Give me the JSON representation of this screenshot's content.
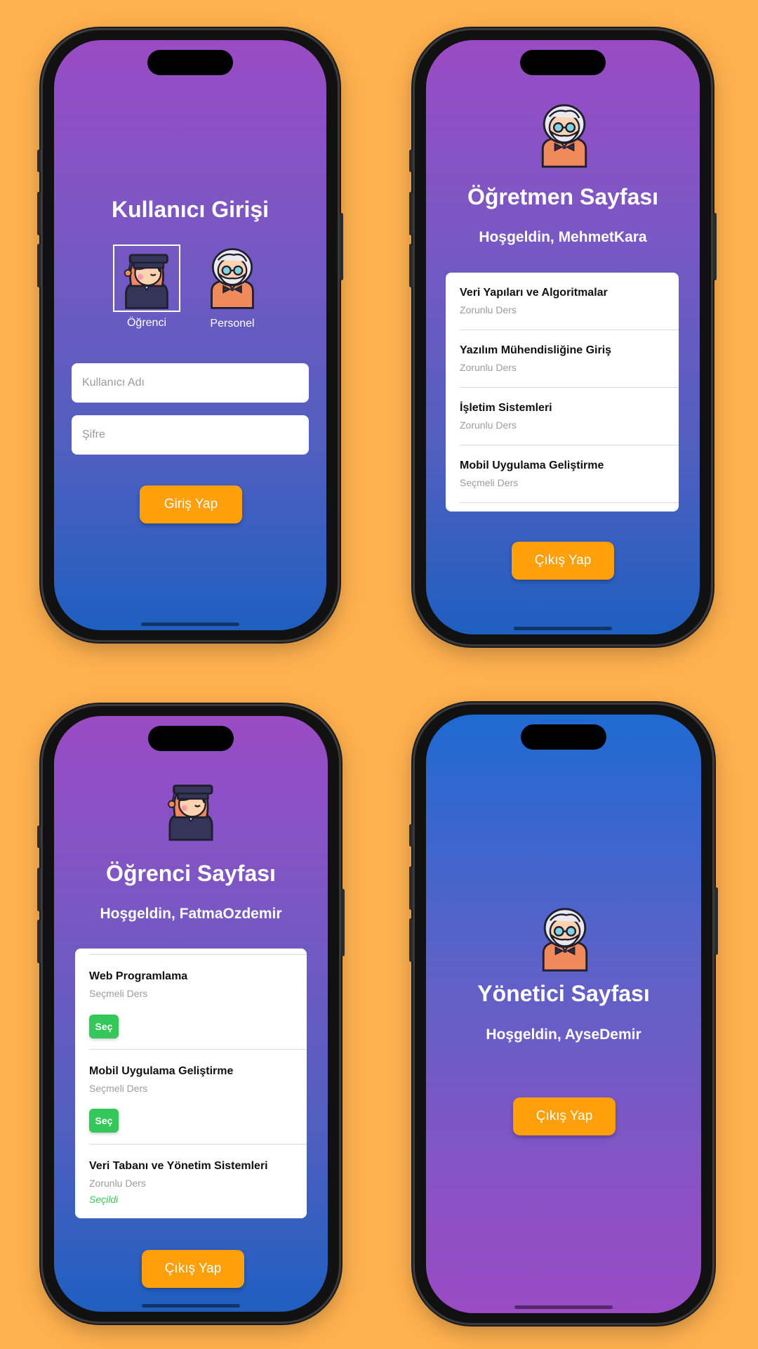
{
  "colors": {
    "background": "#FFB14F",
    "accent_button": "#FF9F0A",
    "select_button": "#34C759",
    "gradient_purple": "#9A4BC4",
    "gradient_blue": "#1E5FC0"
  },
  "login": {
    "title": "Kullanıcı Girişi",
    "roles": [
      {
        "label": "Öğrenci",
        "icon": "student-avatar-icon",
        "selected": true
      },
      {
        "label": "Personel",
        "icon": "professor-avatar-icon",
        "selected": false
      }
    ],
    "username_placeholder": "Kullanıcı Adı",
    "password_placeholder": "Şifre",
    "login_button": "Giriş Yap"
  },
  "teacher": {
    "title": "Öğretmen Sayfası",
    "welcome": "Hoşgeldin, MehmetKara",
    "courses": [
      {
        "name": "Veri Yapıları ve Algoritmalar",
        "type": "Zorunlu Ders"
      },
      {
        "name": "Yazılım Mühendisliğine Giriş",
        "type": "Zorunlu Ders"
      },
      {
        "name": "İşletim Sistemleri",
        "type": "Zorunlu Ders"
      },
      {
        "name": "Mobil Uygulama Geliştirme",
        "type": "Seçmeli Ders"
      }
    ],
    "logout_button": "Çıkış Yap"
  },
  "student": {
    "title": "Öğrenci Sayfası",
    "welcome": "Hoşgeldin, FatmaOzdemir",
    "courses": [
      {
        "name": "Web Programlama",
        "type": "Seçmeli Ders",
        "action": "Seç"
      },
      {
        "name": "Mobil Uygulama Geliştirme",
        "type": "Seçmeli Ders",
        "action": "Seç"
      },
      {
        "name": "Veri Tabanı ve Yönetim Sistemleri",
        "type": "Zorunlu Ders",
        "status": "Seçildi"
      }
    ],
    "logout_button": "Çıkış Yap"
  },
  "admin": {
    "title": "Yönetici Sayfası",
    "welcome": "Hoşgeldin, AyseDemir",
    "logout_button": "Çıkış Yap"
  }
}
